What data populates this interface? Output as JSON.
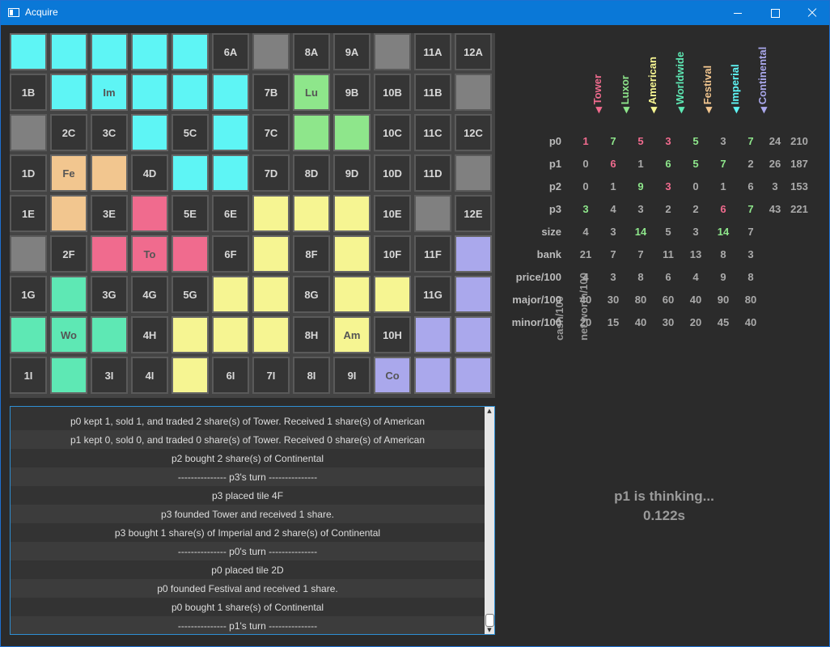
{
  "window": {
    "title": "Acquire"
  },
  "colors": {
    "Tower": "#f06b8e",
    "Luxor": "#8ee68b",
    "American": "#f6f592",
    "Worldwide": "#5ee8b4",
    "Festival": "#f2c68f",
    "Imperial": "#5ef5f5",
    "Continental": "#aaa8ec",
    "unplaced": "#353535",
    "dead": "#808080"
  },
  "board": {
    "rows": [
      [
        {
          "c": "Imperial",
          "t": ""
        },
        {
          "c": "Imperial",
          "t": ""
        },
        {
          "c": "Imperial",
          "t": ""
        },
        {
          "c": "Imperial",
          "t": ""
        },
        {
          "c": "Imperial",
          "t": ""
        },
        {
          "c": "unplaced",
          "t": "6A"
        },
        {
          "c": "dead",
          "t": ""
        },
        {
          "c": "unplaced",
          "t": "8A"
        },
        {
          "c": "unplaced",
          "t": "9A"
        },
        {
          "c": "dead",
          "t": ""
        },
        {
          "c": "unplaced",
          "t": "11A"
        },
        {
          "c": "unplaced",
          "t": "12A"
        }
      ],
      [
        {
          "c": "unplaced",
          "t": "1B"
        },
        {
          "c": "Imperial",
          "t": ""
        },
        {
          "c": "Imperial",
          "t": "Im"
        },
        {
          "c": "Imperial",
          "t": ""
        },
        {
          "c": "Imperial",
          "t": ""
        },
        {
          "c": "Imperial",
          "t": ""
        },
        {
          "c": "unplaced",
          "t": "7B"
        },
        {
          "c": "Luxor",
          "t": "Lu"
        },
        {
          "c": "unplaced",
          "t": "9B"
        },
        {
          "c": "unplaced",
          "t": "10B"
        },
        {
          "c": "unplaced",
          "t": "11B"
        },
        {
          "c": "dead",
          "t": ""
        }
      ],
      [
        {
          "c": "dead",
          "t": ""
        },
        {
          "c": "unplaced",
          "t": "2C"
        },
        {
          "c": "unplaced",
          "t": "3C"
        },
        {
          "c": "Imperial",
          "t": ""
        },
        {
          "c": "unplaced",
          "t": "5C"
        },
        {
          "c": "Imperial",
          "t": ""
        },
        {
          "c": "unplaced",
          "t": "7C"
        },
        {
          "c": "Luxor",
          "t": ""
        },
        {
          "c": "Luxor",
          "t": ""
        },
        {
          "c": "unplaced",
          "t": "10C"
        },
        {
          "c": "unplaced",
          "t": "11C"
        },
        {
          "c": "unplaced",
          "t": "12C"
        }
      ],
      [
        {
          "c": "unplaced",
          "t": "1D"
        },
        {
          "c": "Festival",
          "t": "Fe"
        },
        {
          "c": "Festival",
          "t": ""
        },
        {
          "c": "unplaced",
          "t": "4D"
        },
        {
          "c": "Imperial",
          "t": ""
        },
        {
          "c": "Imperial",
          "t": ""
        },
        {
          "c": "unplaced",
          "t": "7D"
        },
        {
          "c": "unplaced",
          "t": "8D"
        },
        {
          "c": "unplaced",
          "t": "9D"
        },
        {
          "c": "unplaced",
          "t": "10D"
        },
        {
          "c": "unplaced",
          "t": "11D"
        },
        {
          "c": "dead",
          "t": ""
        }
      ],
      [
        {
          "c": "unplaced",
          "t": "1E"
        },
        {
          "c": "Festival",
          "t": ""
        },
        {
          "c": "unplaced",
          "t": "3E"
        },
        {
          "c": "Tower",
          "t": ""
        },
        {
          "c": "unplaced",
          "t": "5E"
        },
        {
          "c": "unplaced",
          "t": "6E"
        },
        {
          "c": "American",
          "t": ""
        },
        {
          "c": "American",
          "t": ""
        },
        {
          "c": "American",
          "t": ""
        },
        {
          "c": "unplaced",
          "t": "10E"
        },
        {
          "c": "dead",
          "t": ""
        },
        {
          "c": "unplaced",
          "t": "12E"
        }
      ],
      [
        {
          "c": "dead",
          "t": ""
        },
        {
          "c": "unplaced",
          "t": "2F"
        },
        {
          "c": "Tower",
          "t": ""
        },
        {
          "c": "Tower",
          "t": "To"
        },
        {
          "c": "Tower",
          "t": ""
        },
        {
          "c": "unplaced",
          "t": "6F"
        },
        {
          "c": "American",
          "t": ""
        },
        {
          "c": "unplaced",
          "t": "8F"
        },
        {
          "c": "American",
          "t": ""
        },
        {
          "c": "unplaced",
          "t": "10F"
        },
        {
          "c": "unplaced",
          "t": "11F"
        },
        {
          "c": "Continental",
          "t": ""
        }
      ],
      [
        {
          "c": "unplaced",
          "t": "1G"
        },
        {
          "c": "Worldwide",
          "t": ""
        },
        {
          "c": "unplaced",
          "t": "3G"
        },
        {
          "c": "unplaced",
          "t": "4G"
        },
        {
          "c": "unplaced",
          "t": "5G"
        },
        {
          "c": "American",
          "t": ""
        },
        {
          "c": "American",
          "t": ""
        },
        {
          "c": "unplaced",
          "t": "8G"
        },
        {
          "c": "American",
          "t": ""
        },
        {
          "c": "American",
          "t": ""
        },
        {
          "c": "unplaced",
          "t": "11G"
        },
        {
          "c": "Continental",
          "t": ""
        }
      ],
      [
        {
          "c": "Worldwide",
          "t": ""
        },
        {
          "c": "Worldwide",
          "t": "Wo"
        },
        {
          "c": "Worldwide",
          "t": ""
        },
        {
          "c": "unplaced",
          "t": "4H"
        },
        {
          "c": "American",
          "t": ""
        },
        {
          "c": "American",
          "t": ""
        },
        {
          "c": "American",
          "t": ""
        },
        {
          "c": "unplaced",
          "t": "8H"
        },
        {
          "c": "American",
          "t": "Am"
        },
        {
          "c": "unplaced",
          "t": "10H"
        },
        {
          "c": "Continental",
          "t": ""
        },
        {
          "c": "Continental",
          "t": ""
        }
      ],
      [
        {
          "c": "unplaced",
          "t": "1I"
        },
        {
          "c": "Worldwide",
          "t": ""
        },
        {
          "c": "unplaced",
          "t": "3I"
        },
        {
          "c": "unplaced",
          "t": "4I"
        },
        {
          "c": "American",
          "t": ""
        },
        {
          "c": "unplaced",
          "t": "6I"
        },
        {
          "c": "unplaced",
          "t": "7I"
        },
        {
          "c": "unplaced",
          "t": "8I"
        },
        {
          "c": "unplaced",
          "t": "9I"
        },
        {
          "c": "Continental",
          "t": "Co"
        },
        {
          "c": "Continental",
          "t": ""
        },
        {
          "c": "Continental",
          "t": ""
        }
      ]
    ]
  },
  "stats": {
    "chains": [
      "Tower",
      "Luxor",
      "American",
      "Worldwide",
      "Festival",
      "Imperial",
      "Continental"
    ],
    "extra_columns": [
      "cash/100",
      "net worth/100"
    ],
    "rows": [
      {
        "label": "p0",
        "vals": [
          {
            "v": "1",
            "h": "red"
          },
          {
            "v": "7",
            "h": "green"
          },
          {
            "v": "5",
            "h": "red"
          },
          {
            "v": "3",
            "h": "red"
          },
          {
            "v": "5",
            "h": "green"
          },
          {
            "v": "3",
            "h": ""
          },
          {
            "v": "7",
            "h": "green"
          },
          {
            "v": "24",
            "h": ""
          },
          {
            "v": "210",
            "h": ""
          }
        ]
      },
      {
        "label": "p1",
        "vals": [
          {
            "v": "0",
            "h": ""
          },
          {
            "v": "6",
            "h": "red"
          },
          {
            "v": "1",
            "h": ""
          },
          {
            "v": "6",
            "h": "green"
          },
          {
            "v": "5",
            "h": "green"
          },
          {
            "v": "7",
            "h": "green"
          },
          {
            "v": "2",
            "h": ""
          },
          {
            "v": "26",
            "h": ""
          },
          {
            "v": "187",
            "h": ""
          }
        ]
      },
      {
        "label": "p2",
        "vals": [
          {
            "v": "0",
            "h": ""
          },
          {
            "v": "1",
            "h": ""
          },
          {
            "v": "9",
            "h": "green"
          },
          {
            "v": "3",
            "h": "red"
          },
          {
            "v": "0",
            "h": ""
          },
          {
            "v": "1",
            "h": ""
          },
          {
            "v": "6",
            "h": ""
          },
          {
            "v": "3",
            "h": ""
          },
          {
            "v": "153",
            "h": ""
          }
        ]
      },
      {
        "label": "p3",
        "vals": [
          {
            "v": "3",
            "h": "green"
          },
          {
            "v": "4",
            "h": ""
          },
          {
            "v": "3",
            "h": ""
          },
          {
            "v": "2",
            "h": ""
          },
          {
            "v": "2",
            "h": ""
          },
          {
            "v": "6",
            "h": "red"
          },
          {
            "v": "7",
            "h": "green"
          },
          {
            "v": "43",
            "h": ""
          },
          {
            "v": "221",
            "h": ""
          }
        ]
      },
      {
        "label": "size",
        "vals": [
          {
            "v": "4",
            "h": ""
          },
          {
            "v": "3",
            "h": ""
          },
          {
            "v": "14",
            "h": "green"
          },
          {
            "v": "5",
            "h": ""
          },
          {
            "v": "3",
            "h": ""
          },
          {
            "v": "14",
            "h": "green"
          },
          {
            "v": "7",
            "h": ""
          }
        ]
      },
      {
        "label": "bank",
        "vals": [
          {
            "v": "21",
            "h": ""
          },
          {
            "v": "7",
            "h": ""
          },
          {
            "v": "7",
            "h": ""
          },
          {
            "v": "11",
            "h": ""
          },
          {
            "v": "13",
            "h": ""
          },
          {
            "v": "8",
            "h": ""
          },
          {
            "v": "3",
            "h": ""
          }
        ]
      },
      {
        "label": "price/100",
        "vals": [
          {
            "v": "4",
            "h": ""
          },
          {
            "v": "3",
            "h": ""
          },
          {
            "v": "8",
            "h": ""
          },
          {
            "v": "6",
            "h": ""
          },
          {
            "v": "4",
            "h": ""
          },
          {
            "v": "9",
            "h": ""
          },
          {
            "v": "8",
            "h": ""
          }
        ]
      },
      {
        "label": "major/100",
        "vals": [
          {
            "v": "40",
            "h": ""
          },
          {
            "v": "30",
            "h": ""
          },
          {
            "v": "80",
            "h": ""
          },
          {
            "v": "60",
            "h": ""
          },
          {
            "v": "40",
            "h": ""
          },
          {
            "v": "90",
            "h": ""
          },
          {
            "v": "80",
            "h": ""
          }
        ]
      },
      {
        "label": "minor/100",
        "vals": [
          {
            "v": "20",
            "h": ""
          },
          {
            "v": "15",
            "h": ""
          },
          {
            "v": "40",
            "h": ""
          },
          {
            "v": "30",
            "h": ""
          },
          {
            "v": "20",
            "h": ""
          },
          {
            "v": "45",
            "h": ""
          },
          {
            "v": "40",
            "h": ""
          }
        ]
      }
    ],
    "highlight_colors": {
      "red": "#f06b8e",
      "green": "#8ee68b"
    }
  },
  "log": {
    "entries": [
      "p0 kept 1, sold 1, and traded 2 share(s) of Tower. Received 1 share(s) of American",
      "p1 kept 0, sold 0, and traded 0 share(s) of Tower. Received 0 share(s) of American",
      "p2 bought 2 share(s) of Continental",
      "--------------- p3's turn ---------------",
      "p3 placed tile 4F",
      "p3 founded Tower and received 1 share.",
      "p3 bought 1 share(s) of Imperial and 2 share(s) of Continental",
      "--------------- p0's turn ---------------",
      "p0 placed tile 2D",
      "p0 founded Festival and received 1 share.",
      "p0 bought 1 share(s) of Continental",
      "--------------- p1's turn ---------------"
    ]
  },
  "status": {
    "line1": "p1 is thinking...",
    "line2": "0.122s"
  }
}
